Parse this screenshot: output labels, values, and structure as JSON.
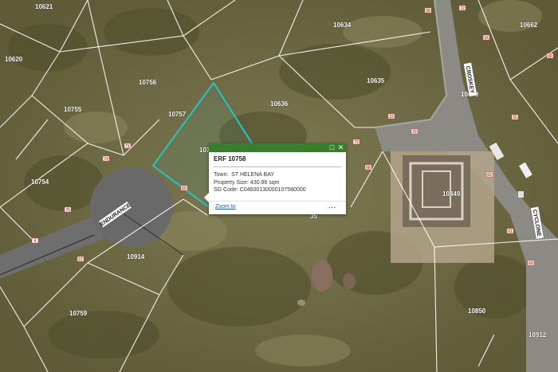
{
  "map": {
    "parcels": [
      "10621",
      "10634",
      "10662",
      "10620",
      "10756",
      "10635",
      "10679",
      "10755",
      "10757",
      "10636",
      "10754",
      "10849",
      "10914",
      "10759",
      "10850",
      "10912"
    ],
    "partial_labels": {
      "under_popup": "107",
      "under_popup_end": "35"
    },
    "roads": [
      "ENDURANCE",
      "CROSKEY",
      "CYCLONE"
    ],
    "markers": [
      "58",
      "54",
      "65",
      "71",
      "74",
      "73",
      "22",
      "66",
      "75",
      "62",
      "4",
      "55",
      "67",
      "69",
      "61",
      "72",
      "70",
      "68",
      "64"
    ]
  },
  "popup": {
    "title": "ERF 10758",
    "town_label": "Town:",
    "town_value": "ST HELENA BAY",
    "size_label": "Property Size:",
    "size_value": "430.86 sqm",
    "sg_label": "SG Code:",
    "sg_value": "C04600130000107580000",
    "zoom_label": "Zoom to",
    "more_label": "...",
    "maximize_icon": "□",
    "close_icon": "✕"
  },
  "colors": {
    "header": "#3a7d2e",
    "highlight": "#27c4c4",
    "link": "#1a5ea8"
  }
}
